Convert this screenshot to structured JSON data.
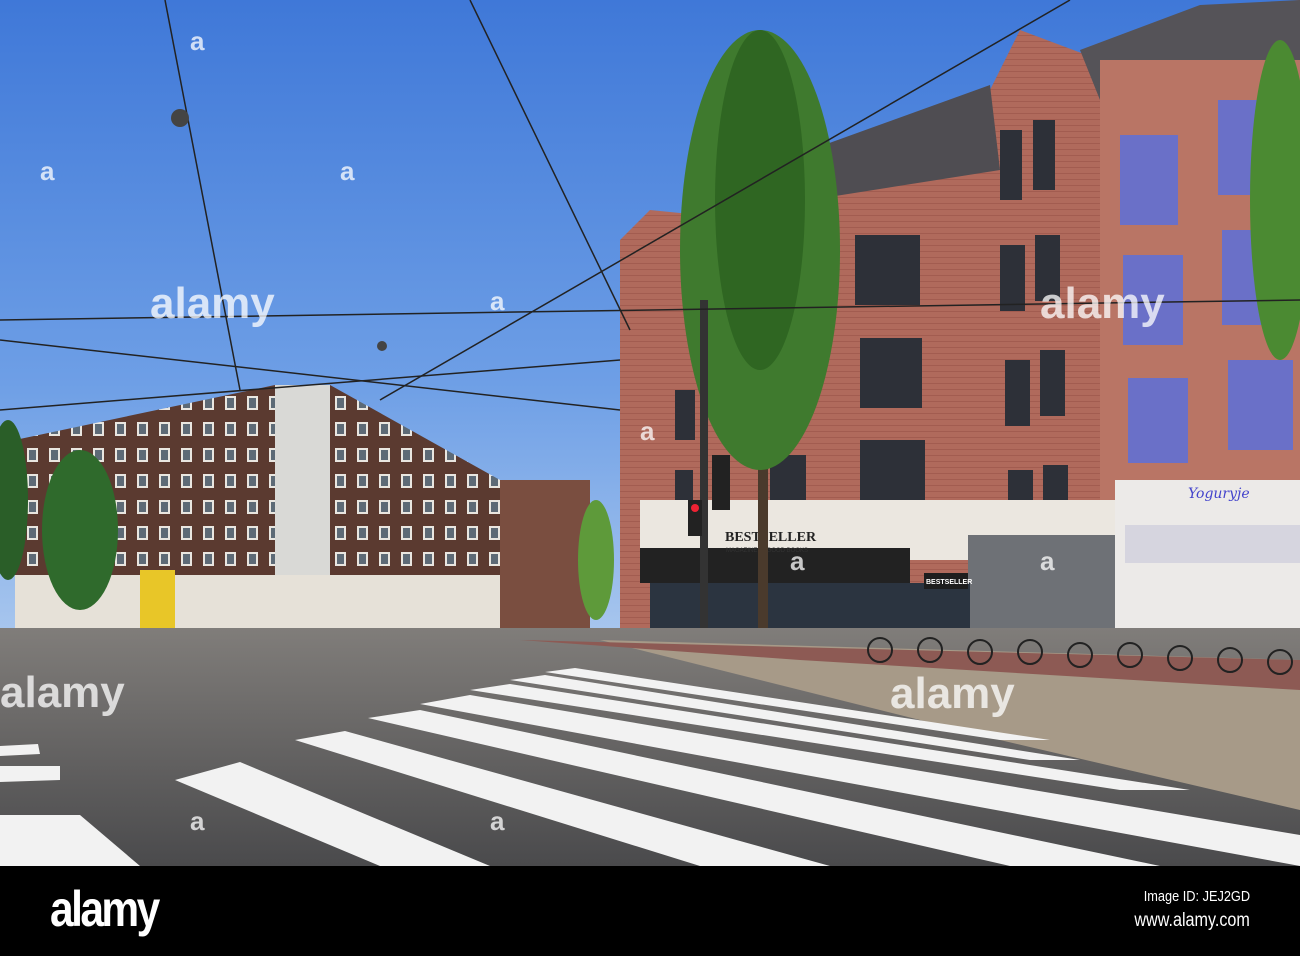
{
  "watermark": {
    "text": "alamy",
    "letter": "a"
  },
  "signs": {
    "bestseller": "BESTSELLER",
    "bestseller_sub": "MAGAZINES · GOOD BOOKS",
    "bestseller_small": "BESTSELLER",
    "yogurt_shop": "Yoguryje"
  },
  "footer": {
    "logo": "alamy",
    "image_id": "Image ID: JEJ2GD",
    "site": "www.alamy.com"
  }
}
